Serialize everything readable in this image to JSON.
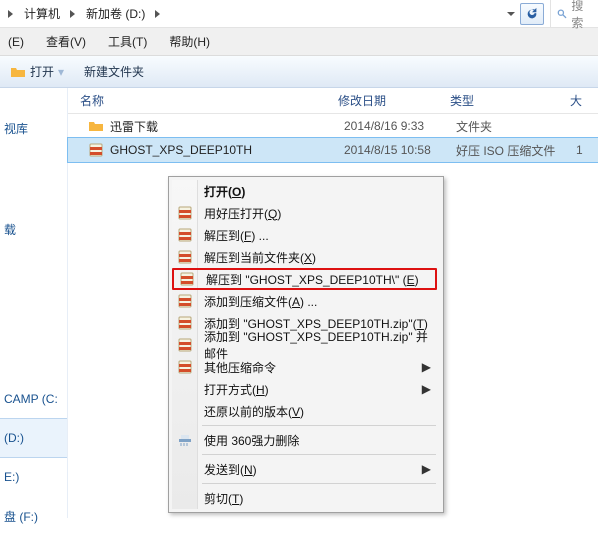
{
  "breadcrumb": {
    "items": [
      "计算机",
      "新加卷 (D:)"
    ],
    "search_placeholder": "搜索"
  },
  "menu": {
    "edit": "(E)",
    "view": "查看(V)",
    "tools": "工具(T)",
    "help": "帮助(H)"
  },
  "toolbar": {
    "open": "打开",
    "sep": "▾",
    "newfolder": "新建文件夹"
  },
  "columns": {
    "name": "名称",
    "date": "修改日期",
    "type": "类型",
    "size": "大"
  },
  "rows": [
    {
      "icon": "folder",
      "name": "迅雷下载",
      "date": "2014/8/16 9:33",
      "type": "文件夹",
      "size": ""
    },
    {
      "icon": "archive",
      "name": "GHOST_XPS_DEEP10TH",
      "date": "2014/8/15 10:58",
      "type": "好压 ISO 压缩文件",
      "size": "1",
      "selected": true
    }
  ],
  "sidebar": {
    "library": "视库",
    "items_tail": [
      "载",
      "CAMP (C:",
      "(D:)",
      "E:)",
      "盘 (F:)"
    ]
  },
  "ctx": {
    "open": "打开(<u>O</u>)",
    "haozip_open": "用好压打开(<u>Q</u>)",
    "extract_to": "解压到(<u>F</u>) ...",
    "extract_here": "解压到当前文件夹(<u>X</u>)",
    "extract_named": "解压到 \"GHOST_XPS_DEEP10TH\\\" (<u>E</u>)",
    "add_archive": "添加到压缩文件(<u>A</u>) ...",
    "add_zip": "添加到 \"GHOST_XPS_DEEP10TH.zip\"(<u>T</u>)",
    "add_zip_mail": "添加到 \"GHOST_XPS_DEEP10TH.zip\" 并邮件",
    "other_cmds": "其他压缩命令",
    "open_with": "打开方式(<u>H</u>)",
    "restore_versions": "还原以前的版本(<u>V</u>)",
    "force_delete": "使用 360强力删除",
    "send_to": "发送到(<u>N</u>)",
    "cut": "剪切(<u>T</u>)"
  }
}
